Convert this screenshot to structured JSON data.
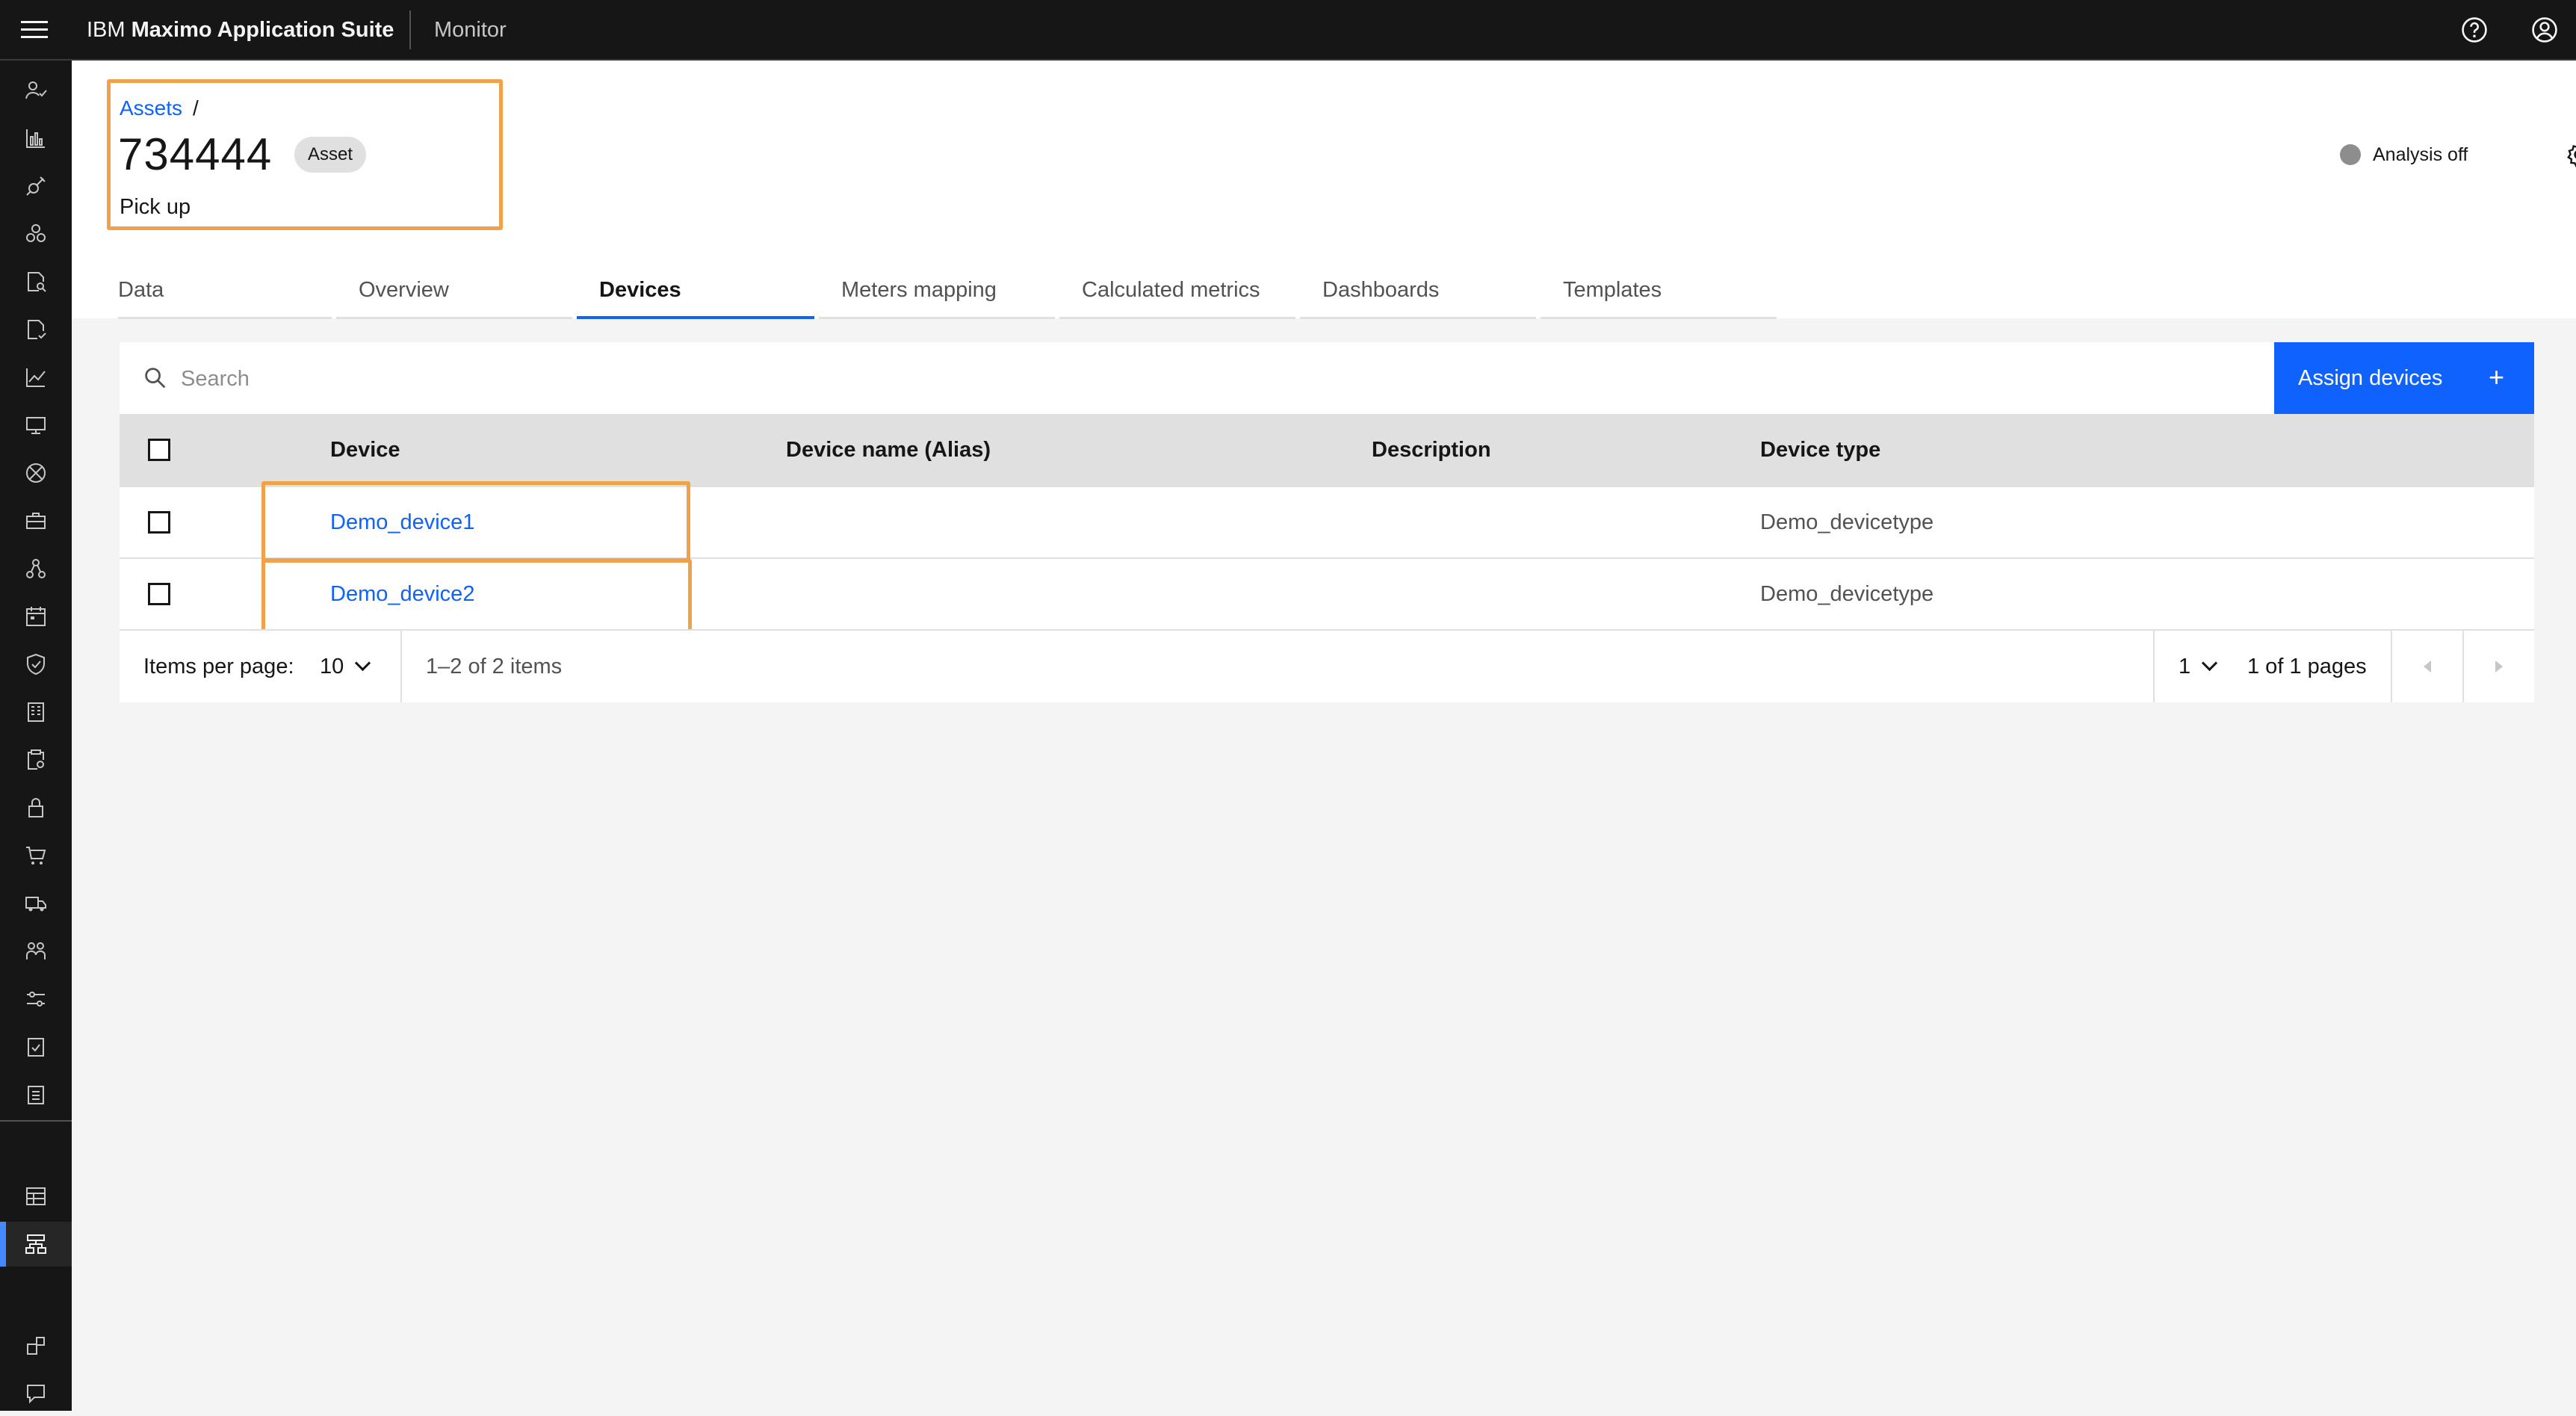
{
  "header": {
    "brand_prefix": "IBM",
    "brand_name": "Maximo Application Suite",
    "app_name": "Monitor"
  },
  "breadcrumb": {
    "parent": "Assets",
    "separator": "/"
  },
  "asset": {
    "id": "734444",
    "tag": "Asset",
    "description": "Pick up"
  },
  "analysis": {
    "label": "Analysis off",
    "status_color": "#8d8d8d"
  },
  "tabs": [
    {
      "label": "Data"
    },
    {
      "label": "Overview"
    },
    {
      "label": "Devices",
      "selected": true
    },
    {
      "label": "Meters mapping"
    },
    {
      "label": "Calculated metrics"
    },
    {
      "label": "Dashboards"
    },
    {
      "label": "Templates"
    }
  ],
  "search": {
    "placeholder": "Search"
  },
  "assign_button": {
    "label": "Assign devices",
    "icon": "+"
  },
  "table": {
    "columns": [
      "Device",
      "Device name (Alias)",
      "Description",
      "Device type"
    ],
    "rows": [
      {
        "device": "Demo_device1",
        "alias": "",
        "description": "",
        "type": "Demo_devicetype"
      },
      {
        "device": "Demo_device2",
        "alias": "",
        "description": "",
        "type": "Demo_devicetype"
      }
    ]
  },
  "pagination": {
    "items_per_page_label": "Items per page:",
    "items_per_page": "10",
    "range_text": "1–2 of 2 items",
    "page": "1",
    "pages_text": "1 of 1 pages"
  },
  "colors": {
    "accent": "#0f62fe",
    "highlight": "#f0a24a",
    "header_bg": "#161616"
  }
}
